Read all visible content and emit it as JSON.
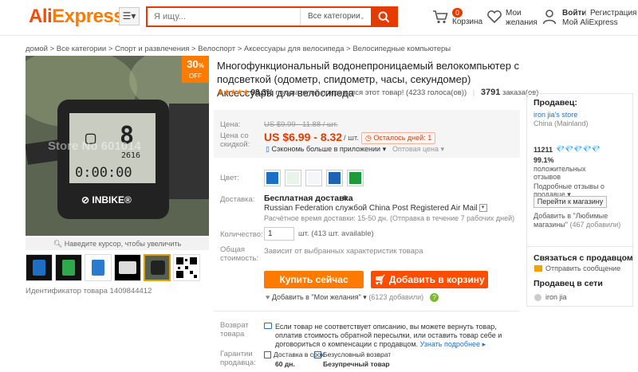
{
  "header": {
    "logo_main": "Ali",
    "logo_accent": "Express",
    "search_placeholder": "Я ищу...",
    "categories_label": "Все категории",
    "cart_count": "0",
    "cart_label": "Корзина",
    "wishlist_line1": "Мои",
    "wishlist_line2": "желания",
    "login_label": "Войти",
    "register_label": "Регистрация",
    "my_account_label": "Мой AliExpress"
  },
  "breadcrumb": "домой > Все категории > Спорт и развлечения > Велоспорт > Аксессуары для велосипеда > Велосипедные компьютеры",
  "gallery": {
    "discount_value": "30",
    "discount_suffix": "%",
    "discount_off": "OFF",
    "zoom_hint": "Наведите курсор, чтобы увеличить",
    "watermark": "Store No 601014",
    "product_id": "Идентификатор товара 1409844412"
  },
  "product": {
    "title": "Многофункциональный водонепроницаемый велокомпьютер с подсветкой (одометр, спидометр, часы, секундомер) Аксессуары для велосипеда",
    "stars": "★★★★★",
    "rating_pct": "98.3%",
    "rating_text": "покупателей понравился этот товар! (4233 голоса(ов))",
    "orders_count": "3791",
    "orders_label": "заказа(ов)",
    "price_label": "Цена:",
    "old_price": "US $9.99 - 11.88 / шт.",
    "discount_price_label_1": "Цена со",
    "discount_price_label_2": "скидкой:",
    "new_price": "US $6.99 - 8.32",
    "unit": "/ шт.",
    "days_left": "Осталось дней: 1",
    "save_app": "Сэкономь больше в приложении",
    "wholesale": "Оптовая цена",
    "color_label": "Цвет:",
    "colors": [
      "#1d6fc4",
      "#e8f4ea",
      "#f3f6fb",
      "#1f64b3",
      "#1d9b3a"
    ],
    "shipping_label": "Доставка:",
    "shipping_title": "Бесплатная доставка",
    "shipping_in": "в",
    "shipping_line": "Russian Federation службой China Post Registered Air Mail",
    "shipping_time": "Расчётное время доставки: 15-50 дн. (Отправка в течение 7 рабочих дней)",
    "qty_label": "Количество:",
    "qty_value": "1",
    "qty_available": "шт. (413 шт. available)",
    "total_label_1": "Общая",
    "total_label_2": "стоимость:",
    "total_note": "Зависит от выбранных характеристик товара",
    "buy_now": "Купить сейчас",
    "add_to_cart": "Добавить в корзину",
    "wishlist": "Добавить в \"Мои желания\"",
    "wishlist_count": "(6123 добавили)",
    "return_label_1": "Возврат",
    "return_label_2": "товара",
    "return_text": "Если товар не соответствует описанию, вы можете вернуть товар, оплатив стоимость обратной пересылки, или оставить товар себе и договориться о компенсации с продавцом.",
    "return_more": "Узнать подробнее",
    "guarantee_label_1": "Гарантии",
    "guarantee_label_2": "продавца:",
    "g_delivery_1": "Доставка в срок",
    "g_delivery_2": "60 дн.",
    "g_return_1": "Безусловный возврат",
    "g_return_2": "Безупречный товар"
  },
  "seller": {
    "heading": "Продавец:",
    "store_name": "iron jia's store",
    "country": "China (Mainland)",
    "score": "11211",
    "diamonds": "💎💎💎💎💎",
    "positive_pct": "99.1%",
    "positive_text_1": "положительных",
    "positive_text_2": "отзывов",
    "details_1": "Подробные отзывы о",
    "details_2": "продавце",
    "goto_shop": "Перейти к магазину",
    "fav_1": "Добавить в \"Любимые",
    "fav_2": "магазины\"",
    "fav_count": "(467 добавили)",
    "contact_heading": "Связаться с продавцом",
    "send_message": "Отправить сообщение",
    "online_heading": "Продавец в сети",
    "online_name": "iron jia"
  }
}
